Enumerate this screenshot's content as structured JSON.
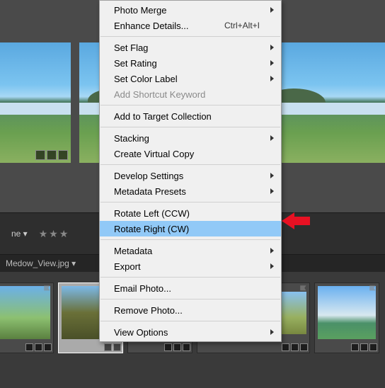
{
  "menu": {
    "photo_merge": "Photo Merge",
    "enhance_details": "Enhance Details...",
    "enhance_details_shortcut": "Ctrl+Alt+I",
    "set_flag": "Set Flag",
    "set_rating": "Set Rating",
    "set_color_label": "Set Color Label",
    "add_shortcut_keyword": "Add Shortcut Keyword",
    "add_to_target": "Add to Target Collection",
    "stacking": "Stacking",
    "create_virtual_copy": "Create Virtual Copy",
    "develop_settings": "Develop Settings",
    "metadata_presets": "Metadata Presets",
    "rotate_left": "Rotate Left (CCW)",
    "rotate_right": "Rotate Right (CW)",
    "metadata": "Metadata",
    "export": "Export",
    "email_photo": "Email Photo...",
    "remove_photo": "Remove Photo...",
    "view_options": "View Options"
  },
  "toolbar": {
    "dropdown_suffix": "ne ▾",
    "stars": "★★★"
  },
  "filebar": {
    "filename": "Medow_View.jpg ▾"
  }
}
